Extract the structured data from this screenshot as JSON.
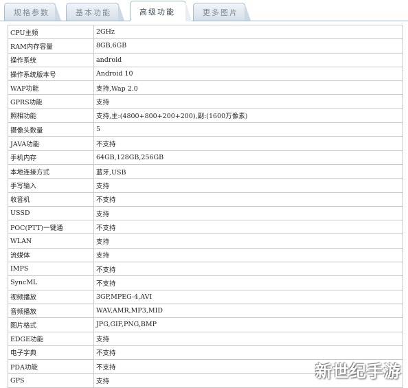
{
  "tabs": [
    {
      "label": "规格参数",
      "active": false
    },
    {
      "label": "基本功能",
      "active": false
    },
    {
      "label": "高级功能",
      "active": true
    },
    {
      "label": "更多图片",
      "active": false
    }
  ],
  "rows": [
    {
      "label": "CPU主频",
      "value": "2GHz"
    },
    {
      "label": "RAM内存容量",
      "value": "8GB,6GB"
    },
    {
      "label": "操作系统",
      "value": "android"
    },
    {
      "label": "操作系统版本号",
      "value": "Android 10"
    },
    {
      "label": "WAP功能",
      "value": "支持,Wap 2.0"
    },
    {
      "label": "GPRS功能",
      "value": "支持"
    },
    {
      "label": "照相功能",
      "value": "支持,主:(4800+800+200+200),副:(1600万像素)"
    },
    {
      "label": "摄像头数量",
      "value": "5"
    },
    {
      "label": "JAVA功能",
      "value": "不支持"
    },
    {
      "label": "手机内存",
      "value": "64GB,128GB,256GB"
    },
    {
      "label": "本地连接方式",
      "value": "蓝牙,USB"
    },
    {
      "label": "手写输入",
      "value": "支持"
    },
    {
      "label": "收音机",
      "value": "不支持"
    },
    {
      "label": "USSD",
      "value": "支持"
    },
    {
      "label": "POC(PTT)一键通",
      "value": "不支持"
    },
    {
      "label": "WLAN",
      "value": "支持"
    },
    {
      "label": "流媒体",
      "value": "支持"
    },
    {
      "label": "IMPS",
      "value": "不支持"
    },
    {
      "label": "SyncML",
      "value": "不支持"
    },
    {
      "label": "视频播放",
      "value": "3GP,MPEG-4,AVI"
    },
    {
      "label": "音频播放",
      "value": "WAV,AMR,MP3,MID"
    },
    {
      "label": "图片格式",
      "value": "JPG,GIF,PNG,BMP"
    },
    {
      "label": "EDGE功能",
      "value": "支持"
    },
    {
      "label": "电子字典",
      "value": "不支持"
    },
    {
      "label": "PDA功能",
      "value": "不支持"
    },
    {
      "label": "GPS",
      "value": "支持"
    }
  ],
  "watermark": "新世纪手游"
}
